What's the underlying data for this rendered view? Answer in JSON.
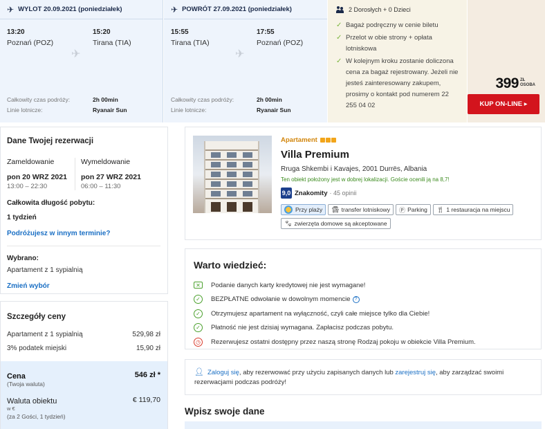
{
  "outbound": {
    "header": "WYLOT 20.09.2021 (poniedziałek)",
    "dep_time": "13:20",
    "dep_airport": "Poznań (POZ)",
    "arr_time": "15:20",
    "arr_airport": "Tirana (TIA)",
    "duration_label": "Całkowity czas podróży:",
    "duration": "2h 00min",
    "airline_label": "Linie lotnicze:",
    "airline": "Ryanair Sun"
  },
  "return": {
    "header": "POWRÓT 27.09.2021 (poniedziałek)",
    "dep_time": "15:55",
    "dep_airport": "Tirana (TIA)",
    "arr_time": "17:55",
    "arr_airport": "Poznań (POZ)",
    "duration_label": "Całkowity czas podróży:",
    "duration": "2h 00min",
    "airline_label": "Linie lotnicze:",
    "airline": "Ryanair Sun"
  },
  "info": {
    "passengers": "2 Dorosłych + 0 Dzieci",
    "bullets": [
      "Bagaż podręczny w cenie biletu",
      "Przelot w obie strony + opłata lotniskowa",
      "W kolejnym kroku zostanie doliczona cena za bagaż rejestrowany. Jeżeli nie jesteś zainteresowany zakupem, prosimy o kontakt pod numerem 22 255 04 02"
    ]
  },
  "offer": {
    "price": "399",
    "currency": "ZŁ",
    "per": "OSOBA",
    "buy_label": "KUP ON-LINE ▸"
  },
  "reservation": {
    "title": "Dane Twojej rezerwacji",
    "checkin_label": "Zameldowanie",
    "checkin_date": "pon 20 WRZ 2021",
    "checkin_hours": "13:00 – 22:30",
    "checkout_label": "Wymeldowanie",
    "checkout_date": "pon 27 WRZ 2021",
    "checkout_hours": "06:00 – 11:30",
    "stay_label": "Całkowita długość pobytu:",
    "stay_value": "1 tydzień",
    "other_dates_link": "Podróżujesz w innym terminie?",
    "selected_label": "Wybrano:",
    "selected_value": "Apartament z 1 sypialnią",
    "change_link": "Zmień wybór"
  },
  "price_details": {
    "title": "Szczegóły ceny",
    "rows": [
      {
        "label": "Apartament z 1 sypialnią",
        "value": "529,98 zł"
      },
      {
        "label": "3% podatek miejski",
        "value": "15,90 zł"
      }
    ],
    "total_label": "Cena",
    "total_value": "546 zł *",
    "total_note": "(Twoja waluta)",
    "local_label": "Waluta obiektu",
    "local_value": "€ 119,70",
    "local_cur": "w €",
    "local_note": "(za 2 Gości,   1 tydzień)"
  },
  "hotel": {
    "type": "Apartament",
    "stars": 3,
    "name": "Villa Premium",
    "address": "Rruga Shkembi i Kavajes, 2001 Durrës, Albania",
    "location_note": "Ten obiekt położony jest w dobrej lokalizacji. Goście ocenili ją na 8,7!",
    "score": "9,0",
    "score_label": "Znakomity",
    "reviews": "· 45 opinii",
    "features": [
      "Przy plaży",
      "transfer lotniskowy",
      "Parking",
      "1 restauracja na miejscu",
      "zwierzęta domowe są akceptowane"
    ]
  },
  "worth": {
    "title": "Warto wiedzieć:",
    "items": [
      "Podanie danych karty kredytowej nie jest wymagane!",
      "BEZPŁATNE odwołanie w dowolnym momencie",
      "Otrzymujesz apartament na wyłączność, czyli całe miejsce tylko dla Ciebie!",
      "Płatność nie jest dzisiaj wymagana. Zapłacisz podczas pobytu.",
      "Rezerwujesz ostatni dostępny przez naszą stronę Rodzaj pokoju w obiekcie Villa Premium."
    ]
  },
  "login": {
    "login_link": "Zaloguj się",
    "text_1": ", aby rezerwować przy użyciu zapisanych danych lub ",
    "register_link": "zarejestruj się",
    "text_2": ", aby zarządzać swoimi rezerwacjami podczas podróży!"
  },
  "enter_title": "Wpisz swoje dane"
}
